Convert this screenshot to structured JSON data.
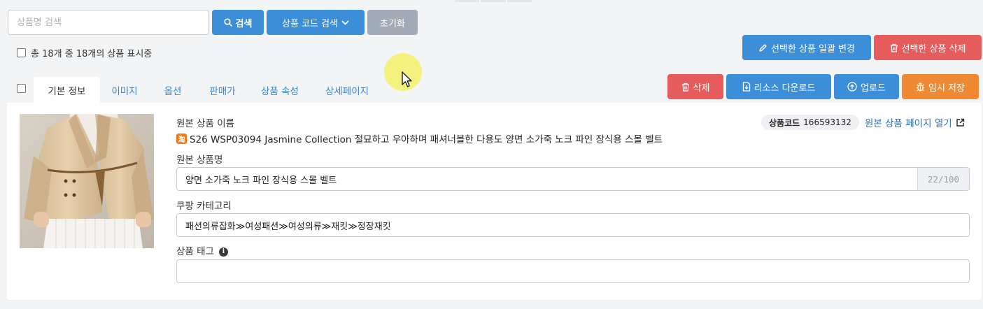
{
  "search": {
    "placeholder": "상품명 검색",
    "search_button": "검색",
    "code_search_button": "상품 코드 검색",
    "reset_button": "초기화"
  },
  "summary": {
    "count_text": "총 18개 중 18개의 상품 표시중"
  },
  "bulk_actions": {
    "bulk_edit": "선택한 상품 일괄 변경",
    "bulk_delete": "선택한 상품 삭제"
  },
  "tabs": [
    {
      "label": "기본 정보"
    },
    {
      "label": "이미지"
    },
    {
      "label": "옵션"
    },
    {
      "label": "판매가"
    },
    {
      "label": "상품 속성"
    },
    {
      "label": "상세페이지"
    }
  ],
  "row_actions": {
    "delete": "삭제",
    "download": "리소스 다운로드",
    "upload": "업로드",
    "temp_save": "임시 저장"
  },
  "product": {
    "original_name_label": "원본 상품 이름",
    "original_name": "S26 WSP03094 Jasmine Collection 절묘하고 우아하며 패셔너블한 다용도 양면 소가죽 노크 파인 장식용 스몰 벨트",
    "source_badge": "淘",
    "code_label": "상품코드",
    "code_value": "166593132",
    "open_page_link": "원본 상품 페이지 열기",
    "name_field_label": "원본 상품명",
    "name_field_value": "양면 소가죽 노크 파인 장식용 스몰 벨트",
    "name_counter": "22/100",
    "category_label": "쿠팡 카테고리",
    "category_value": "패션의류잡화≫여성패션≫여성의류≫재킷≫정장재킷",
    "tags_label": "상품 태그",
    "tags_value": ""
  },
  "colors": {
    "primary": "#3d8ed8",
    "danger": "#e65c5c",
    "warning": "#ef8a32",
    "muted": "#a2abb5"
  },
  "icons": {
    "search_button": "search-icon",
    "code_search_button": "chevron-down-icon",
    "bulk_edit": "pencil-icon",
    "bulk_delete": "trash-icon",
    "delete": "trash-icon",
    "download": "file-download-icon",
    "upload": "cloud-upload-icon",
    "temp_save": "bug-icon",
    "open_page_link": "external-link-icon",
    "tags_label": "info-icon"
  }
}
